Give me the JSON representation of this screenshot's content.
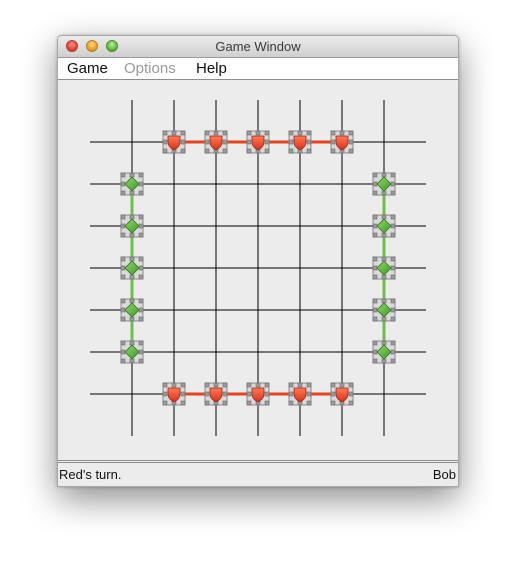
{
  "window": {
    "title": "Game Window"
  },
  "menu": {
    "items": [
      {
        "label": "Game",
        "enabled": true
      },
      {
        "label": "Options",
        "enabled": false
      },
      {
        "label": "Help",
        "enabled": true
      }
    ]
  },
  "board": {
    "grid_size": 7,
    "red_pieces": [
      {
        "col": 1,
        "row": 0
      },
      {
        "col": 2,
        "row": 0
      },
      {
        "col": 3,
        "row": 0
      },
      {
        "col": 4,
        "row": 0
      },
      {
        "col": 5,
        "row": 0
      },
      {
        "col": 1,
        "row": 6
      },
      {
        "col": 2,
        "row": 6
      },
      {
        "col": 3,
        "row": 6
      },
      {
        "col": 4,
        "row": 6
      },
      {
        "col": 5,
        "row": 6
      }
    ],
    "green_pieces": [
      {
        "col": 0,
        "row": 1
      },
      {
        "col": 0,
        "row": 2
      },
      {
        "col": 0,
        "row": 3
      },
      {
        "col": 0,
        "row": 4
      },
      {
        "col": 0,
        "row": 5
      },
      {
        "col": 6,
        "row": 1
      },
      {
        "col": 6,
        "row": 2
      },
      {
        "col": 6,
        "row": 3
      },
      {
        "col": 6,
        "row": 4
      },
      {
        "col": 6,
        "row": 5
      }
    ],
    "red_piece_icon": "red-shield-icon",
    "green_piece_icon": "green-diamond-icon"
  },
  "colors": {
    "red": "#e8431f",
    "green": "#5cb33c",
    "red_link": "#e8431f",
    "green_link": "#6cc04a",
    "grid": "#000000"
  },
  "status": {
    "message": "Red's turn.",
    "player": "Bob"
  }
}
